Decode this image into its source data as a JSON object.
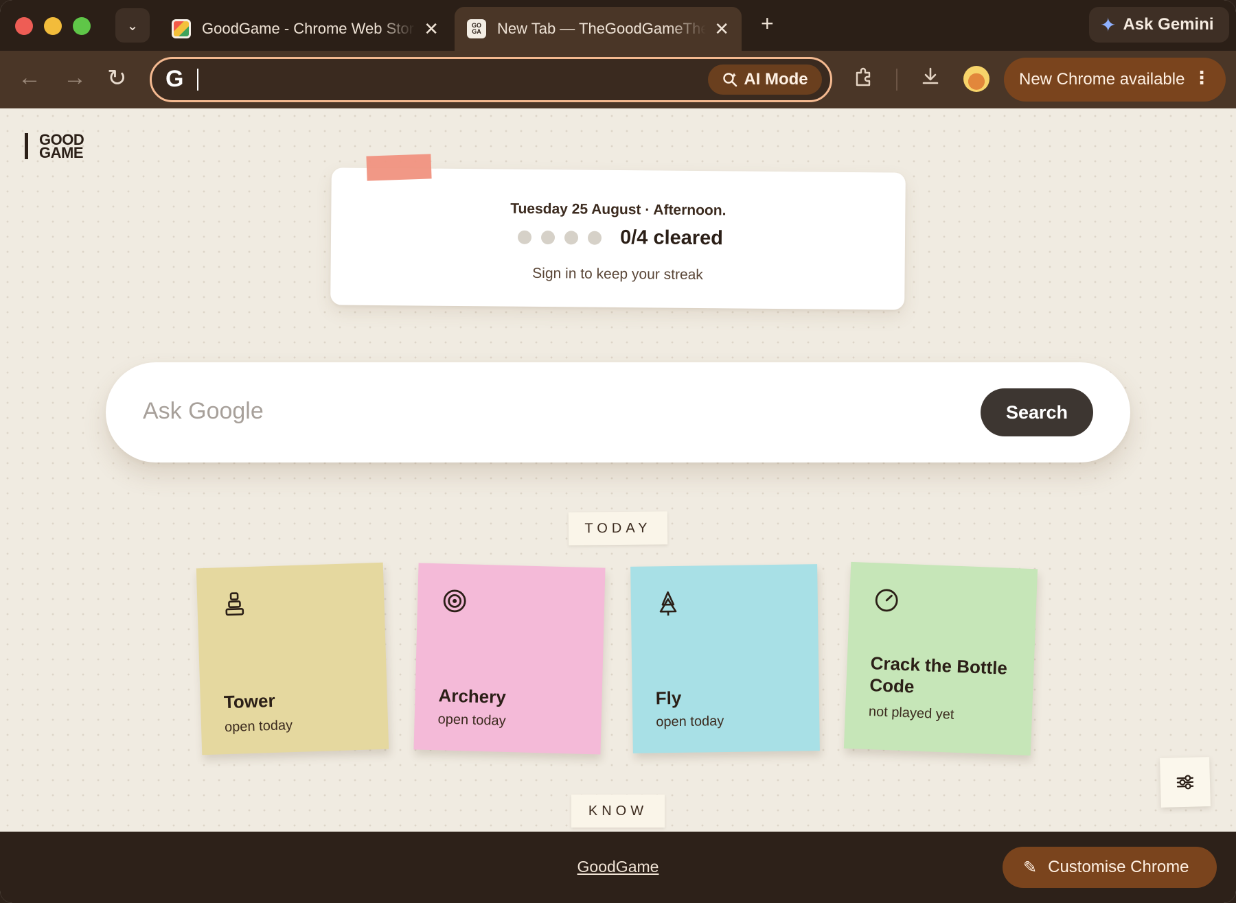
{
  "tabs": [
    {
      "title": "GoodGame - Chrome Web Store",
      "favicon": "chrome-web-store-icon",
      "active": false
    },
    {
      "title": "New Tab — TheGoodGameTheory",
      "favicon": "goodgame-favicon",
      "active": true
    }
  ],
  "favicon_text": {
    "line1": "GO",
    "line2": "GA"
  },
  "new_tab_symbol": "+",
  "close_symbol": "✕",
  "gemini": {
    "label": "Ask Gemini"
  },
  "toolbar": {
    "omnibox_value": "",
    "ai_mode_label": "AI Mode",
    "update_label": "New Chrome available",
    "update_menu": "⋮"
  },
  "brand": {
    "line1": "GOOD",
    "line2": "GAME"
  },
  "status": {
    "date": "Tuesday 25 August · Afternoon.",
    "cleared_count": 0,
    "total": 4,
    "cleared_label": "0/4 cleared",
    "sub": "Sign in to keep your streak"
  },
  "search": {
    "placeholder": "Ask Google",
    "button_label": "Search"
  },
  "sections": {
    "today": "TODAY",
    "know": "KNOW"
  },
  "games": [
    {
      "name": "Tower",
      "status": "open today",
      "icon": "tower-icon",
      "color": "#e5d89f"
    },
    {
      "name": "Archery",
      "status": "open today",
      "icon": "target-icon",
      "color": "#f4bad8"
    },
    {
      "name": "Fly",
      "status": "open today",
      "icon": "tree-icon",
      "color": "#a8e0e6"
    },
    {
      "name": "Crack the Bottle Code",
      "status": "not played yet",
      "icon": "gauge-icon",
      "color": "#c6e6b8"
    }
  ],
  "footer": {
    "link": "GoodGame",
    "customise_label": "Customise Chrome"
  },
  "colors": {
    "accent": "#7a441d",
    "frame": "#2b1f17",
    "toolbar": "#4a3627",
    "omnibox_border": "#f4b990",
    "tape": "#f0927f"
  }
}
